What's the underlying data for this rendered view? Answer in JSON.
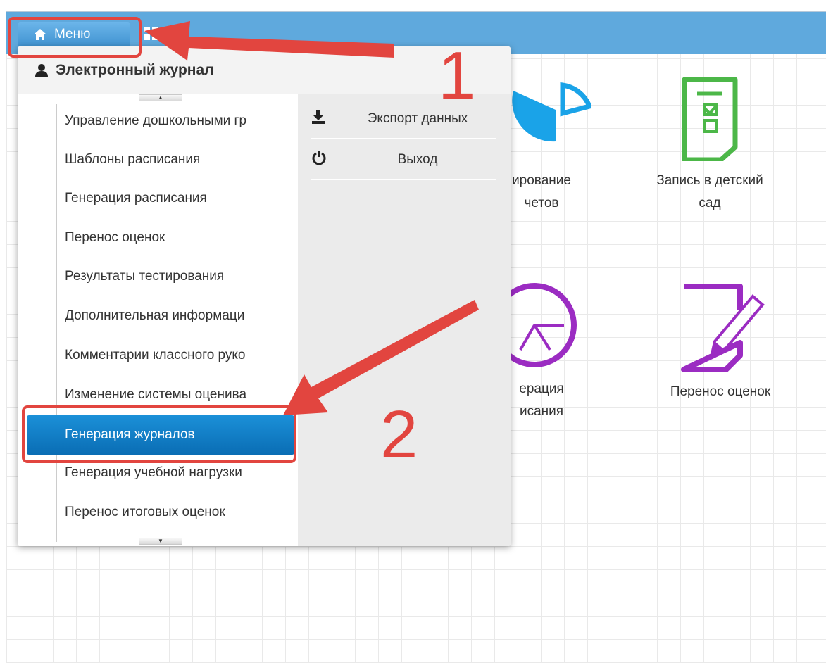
{
  "topbar": {
    "menu_label": "Меню",
    "home_icon": "home-icon",
    "grid_icon": "grid-icon"
  },
  "tiles": [
    {
      "name": "tile-reports",
      "label_line1": "ирование",
      "label_line2": "четов",
      "icon": "pie-chart-icon",
      "color": "#1aa3e8"
    },
    {
      "name": "tile-kindergarten",
      "label_line1": "Запись в детский",
      "label_line2": "сад",
      "icon": "checklist-document-icon",
      "color": "#4cb748"
    },
    {
      "name": "tile-schedule",
      "label_line1": "ерация",
      "label_line2": "исания",
      "icon": "clock-icon",
      "color": "#9b2cc2"
    },
    {
      "name": "tile-grade-transfer",
      "label_line1": "Перенос оценок",
      "label_line2": "",
      "icon": "edit-document-icon",
      "color": "#9b2cc2"
    }
  ],
  "dropdown": {
    "header": "Электронный журнал",
    "header_icon": "user-icon",
    "items": [
      "Управление дошкольными гр",
      "Шаблоны расписания",
      "Генерация расписания",
      "Перенос оценок",
      "Результаты тестирования",
      "Дополнительная информаци",
      "Комментарии классного руко",
      "Изменение системы оценива",
      "Генерация журналов",
      "Генерация учебной нагрузки",
      "Перенос итоговых оценок"
    ],
    "active_index": 8,
    "right": {
      "export_label": "Экспорт данных",
      "export_icon": "download-icon",
      "logout_label": "Выход",
      "logout_icon": "power-icon"
    }
  },
  "annotations": {
    "num1": "1",
    "num2": "2",
    "color": "#e2453f"
  },
  "colors": {
    "topbar": "#5fa9dd",
    "active_item": "#1b90d8",
    "dropdown_right": "#ebebeb"
  }
}
